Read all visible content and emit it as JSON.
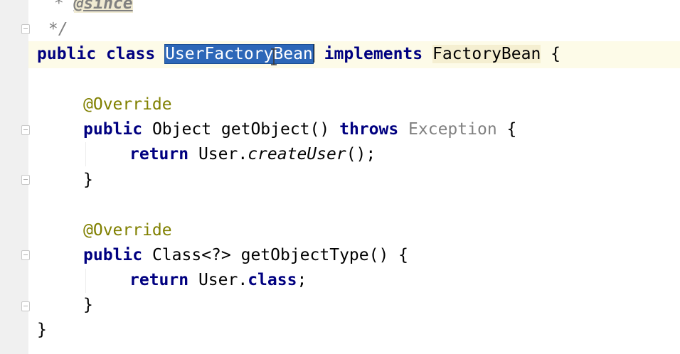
{
  "editor": {
    "language": "Java",
    "colors": {
      "background": "#ffffff",
      "gutter": "#f0f0f0",
      "keyword": "#000080",
      "comment": "#808080",
      "annotation": "#808000",
      "selection": "#2d67b8",
      "current_line": "#fdfbe8"
    },
    "lines": [
      {
        "comment_star": " * ",
        "tag": "@since"
      },
      {
        "comment_end": " */"
      },
      {
        "kw_public": "public",
        "kw_class": "class",
        "selected_name": "UserFactoryBean",
        "kw_implements": "implements",
        "interface_name": "FactoryBean",
        "brace": "{"
      },
      {
        "annotation": "@Override"
      },
      {
        "kw_public": "public",
        "return_type": "Object",
        "method": "getObject()",
        "kw_throws": "throws",
        "exception": "Exception",
        "brace": "{"
      },
      {
        "kw_return": "return",
        "receiver": "User.",
        "call": "createUser",
        "tail": "();"
      },
      {
        "close": "}"
      },
      {
        "annotation": "@Override"
      },
      {
        "kw_public": "public",
        "return_type": "Class<?>",
        "method": "getObjectType()",
        "brace": "{"
      },
      {
        "kw_return": "return",
        "receiver": "User.",
        "kw_class": "class",
        "tail": ";"
      },
      {
        "close": "}"
      },
      {
        "close": "}"
      }
    ]
  }
}
